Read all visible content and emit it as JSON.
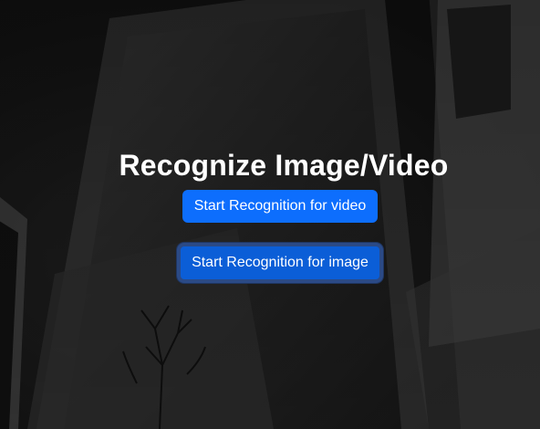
{
  "page": {
    "title": "Recognize Image/Video"
  },
  "actions": {
    "video_button_label": "Start Recognition for video",
    "image_button_label": "Start Recognition for image"
  },
  "colors": {
    "primary": "#0d6efd",
    "primary_focused": "#0b5ed7",
    "focus_ring": "#2b4a86",
    "title_text": "#ffffff"
  }
}
